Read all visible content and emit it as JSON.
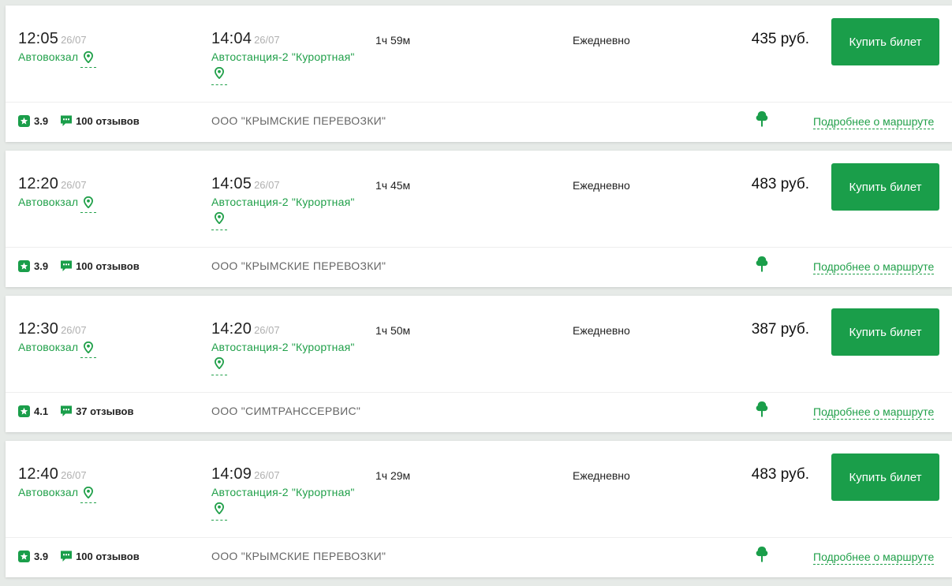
{
  "colors": {
    "accent": "#1a9e4a",
    "link": "#21a04a",
    "muted": "#b0b0b0",
    "background": "#e6eae7"
  },
  "icons": {
    "location": "map-pin-icon",
    "rating": "star-icon",
    "reviews": "chat-icon",
    "eco": "tree-icon"
  },
  "trips": [
    {
      "departure_time": "12:05",
      "departure_date": "26/07",
      "departure_station": "Автовокзал",
      "arrival_time": "14:04",
      "arrival_date": "26/07",
      "arrival_station": "Автостанция-2 \"Курортная\"",
      "duration": "1ч 59м",
      "schedule": "Ежедневно",
      "price": "435 руб.",
      "buy_label": "Купить билет",
      "rating": "3.9",
      "reviews": "100 отзывов",
      "carrier": "ООО \"КРЫМСКИЕ ПЕРЕВОЗКИ\"",
      "details_label": "Подробнее о маршруте"
    },
    {
      "departure_time": "12:20",
      "departure_date": "26/07",
      "departure_station": "Автовокзал",
      "arrival_time": "14:05",
      "arrival_date": "26/07",
      "arrival_station": "Автостанция-2 \"Курортная\"",
      "duration": "1ч 45м",
      "schedule": "Ежедневно",
      "price": "483 руб.",
      "buy_label": "Купить билет",
      "rating": "3.9",
      "reviews": "100 отзывов",
      "carrier": "ООО \"КРЫМСКИЕ ПЕРЕВОЗКИ\"",
      "details_label": "Подробнее о маршруте"
    },
    {
      "departure_time": "12:30",
      "departure_date": "26/07",
      "departure_station": "Автовокзал",
      "arrival_time": "14:20",
      "arrival_date": "26/07",
      "arrival_station": "Автостанция-2 \"Курортная\"",
      "duration": "1ч 50м",
      "schedule": "Ежедневно",
      "price": "387 руб.",
      "buy_label": "Купить билет",
      "rating": "4.1",
      "reviews": "37 отзывов",
      "carrier": "ООО \"СИМТРАНССЕРВИС\"",
      "details_label": "Подробнее о маршруте"
    },
    {
      "departure_time": "12:40",
      "departure_date": "26/07",
      "departure_station": "Автовокзал",
      "arrival_time": "14:09",
      "arrival_date": "26/07",
      "arrival_station": "Автостанция-2 \"Курортная\"",
      "duration": "1ч 29м",
      "schedule": "Ежедневно",
      "price": "483 руб.",
      "buy_label": "Купить билет",
      "rating": "3.9",
      "reviews": "100 отзывов",
      "carrier": "ООО \"КРЫМСКИЕ ПЕРЕВОЗКИ\"",
      "details_label": "Подробнее о маршруте"
    }
  ]
}
